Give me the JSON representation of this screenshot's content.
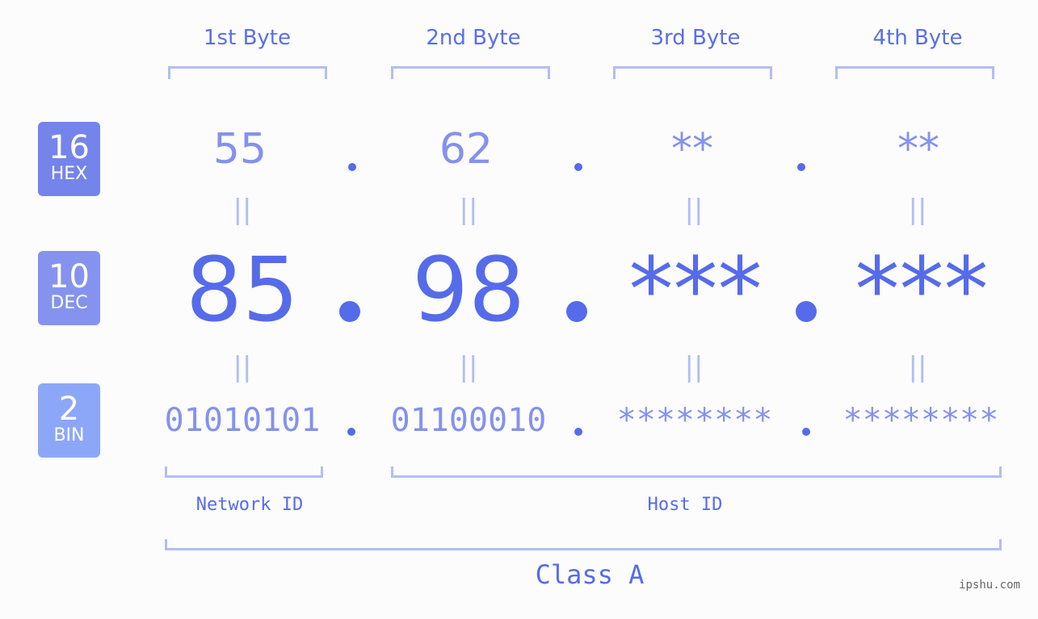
{
  "bases": [
    {
      "num": "16",
      "label": "HEX",
      "color": "#7584ea"
    },
    {
      "num": "10",
      "label": "DEC",
      "color": "#8593ef"
    },
    {
      "num": "2",
      "label": "BIN",
      "color": "#8da7f8"
    }
  ],
  "bytes": [
    {
      "header": "1st Byte",
      "hex": "55",
      "dec": "85",
      "bin": "01010101"
    },
    {
      "header": "2nd Byte",
      "hex": "62",
      "dec": "98",
      "bin": "01100010"
    },
    {
      "header": "3rd Byte",
      "hex": "**",
      "dec": "***",
      "bin": "********"
    },
    {
      "header": "4th Byte",
      "hex": "**",
      "dec": "***",
      "bin": "********"
    }
  ],
  "equals_glyph": "||",
  "network_label": "Network ID",
  "host_label": "Host ID",
  "class_label": "Class A",
  "watermark": "ipshu.com"
}
